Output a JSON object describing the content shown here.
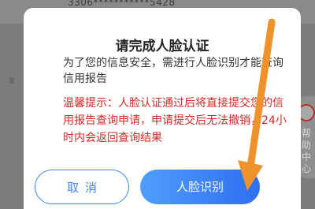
{
  "background": {
    "account_text": "3306***********5428",
    "help_label": "帮助中心"
  },
  "dialog": {
    "title": "请完成人脸认证",
    "description": "为了您的信息安全，需进行人脸识别才能查询信用报告",
    "warning": "温馨提示：人脸认证通过后将直接提交您的信用报告查询申请，申请提交后无法撤销，24小时内会返回查询结果",
    "cancel_label": "取消",
    "confirm_label": "人脸识别"
  },
  "colors": {
    "accent": "#3d86f6",
    "warning": "#d42a27",
    "arrow": "#f0922b"
  }
}
